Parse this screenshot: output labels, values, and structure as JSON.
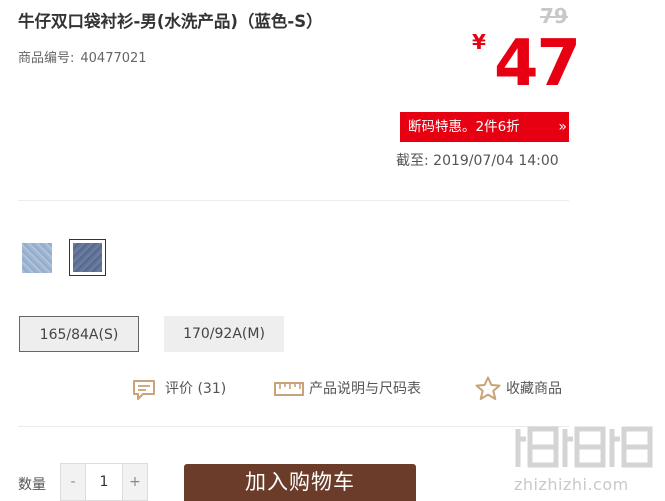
{
  "product": {
    "title": "牛仔双口袋衬衫-男(水洗产品)（蓝色-S）",
    "sku_label": "商品编号:",
    "sku_value": "40477021"
  },
  "pricing": {
    "original_price": "79",
    "currency_symbol": "¥",
    "current_price": "47",
    "promo_label": "断码特惠。2件6折",
    "promo_arrow": "»",
    "deadline_label": "截至:",
    "deadline_value": "2019/07/04 14:00",
    "accent_color": "#e60012"
  },
  "colors": {
    "options": [
      "light-denim",
      "dark-denim"
    ],
    "selected": "dark-denim"
  },
  "sizes": {
    "options": [
      "165/84A(S)",
      "170/92A(M)"
    ],
    "selected": "165/84A(S)"
  },
  "actions": {
    "review_label": "评价 (31)",
    "size_chart_label": "产品说明与尺码表",
    "favorite_label": "收藏商品"
  },
  "purchase": {
    "quantity_label": "数量",
    "minus": "-",
    "quantity_value": "1",
    "plus": "+",
    "add_to_cart": "加入购物车",
    "button_color": "#6b3c2a"
  },
  "watermark": {
    "logo_text": "值值值",
    "site_text": "zhizhizhi.com"
  }
}
